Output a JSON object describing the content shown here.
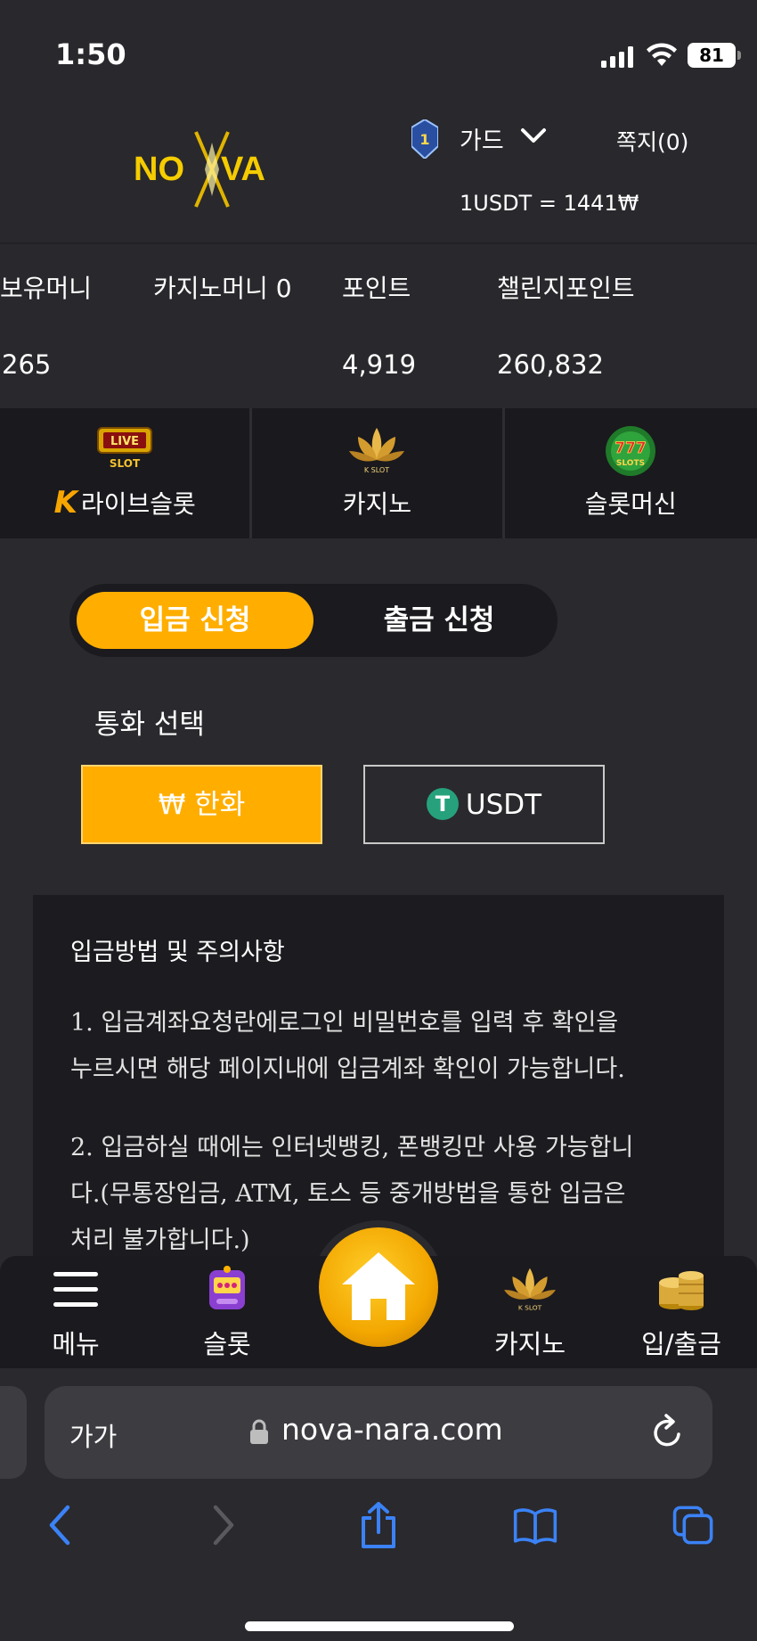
{
  "status": {
    "time": "1:50",
    "battery": "81"
  },
  "header": {
    "logo_text": "NOVA",
    "level": "1",
    "user_name": "가드",
    "messages": "쪽지(0)",
    "exchange_rate": "1USDT = 1441₩"
  },
  "balances": {
    "money_label": "보유머니",
    "money_value": "265",
    "casino_money_label": "카지노머니 0",
    "points_label": "포인트",
    "points_value": "4,919",
    "challenge_label": "챌린지포인트",
    "challenge_value": "260,832"
  },
  "game_tabs": [
    {
      "label": "라이브슬롯",
      "k_mark": "K",
      "icon_text": "LIVE",
      "icon_sub": "SLOT"
    },
    {
      "label": "카지노",
      "icon_sub": "K SLOT"
    },
    {
      "label": "슬롯머신",
      "icon_text": "777",
      "icon_sub": "SLOTS"
    }
  ],
  "deposit": {
    "tab_deposit": "입금 신청",
    "tab_withdraw": "출금 신청",
    "currency_title": "통화 선택",
    "currency_krw": "₩ 한화",
    "currency_usdt": "USDT",
    "usdt_symbol": "T"
  },
  "notice": {
    "title": "입금방법 및 주의사항",
    "line1a": "1. 입금계좌요청란에로그인 비밀번호를 입력 후 확인을",
    "line1b": "누르시면 해당 페이지내에 입금계좌 확인이 가능합니다.",
    "line2a": "2. 입금하실 때에는 인터넷뱅킹, 폰뱅킹만 사용 가능합니",
    "line2b": "다.(무통장입금, ATM, 토스 등 중개방법을 통한 입금은",
    "line2c": "처리 불가합니다.)"
  },
  "bottom_nav": {
    "menu": "메뉴",
    "slot": "슬롯",
    "casino": "카지노",
    "casino_icon_sub": "K SLOT",
    "deposit_withdraw": "입/출금"
  },
  "browser": {
    "aa": "가가",
    "url": "nova-nara.com"
  },
  "colors": {
    "accent": "#ffae00",
    "background": "#2a292d",
    "panel": "#1c1b1f",
    "tether": "#26a17b",
    "link_blue": "#3b82f6"
  }
}
